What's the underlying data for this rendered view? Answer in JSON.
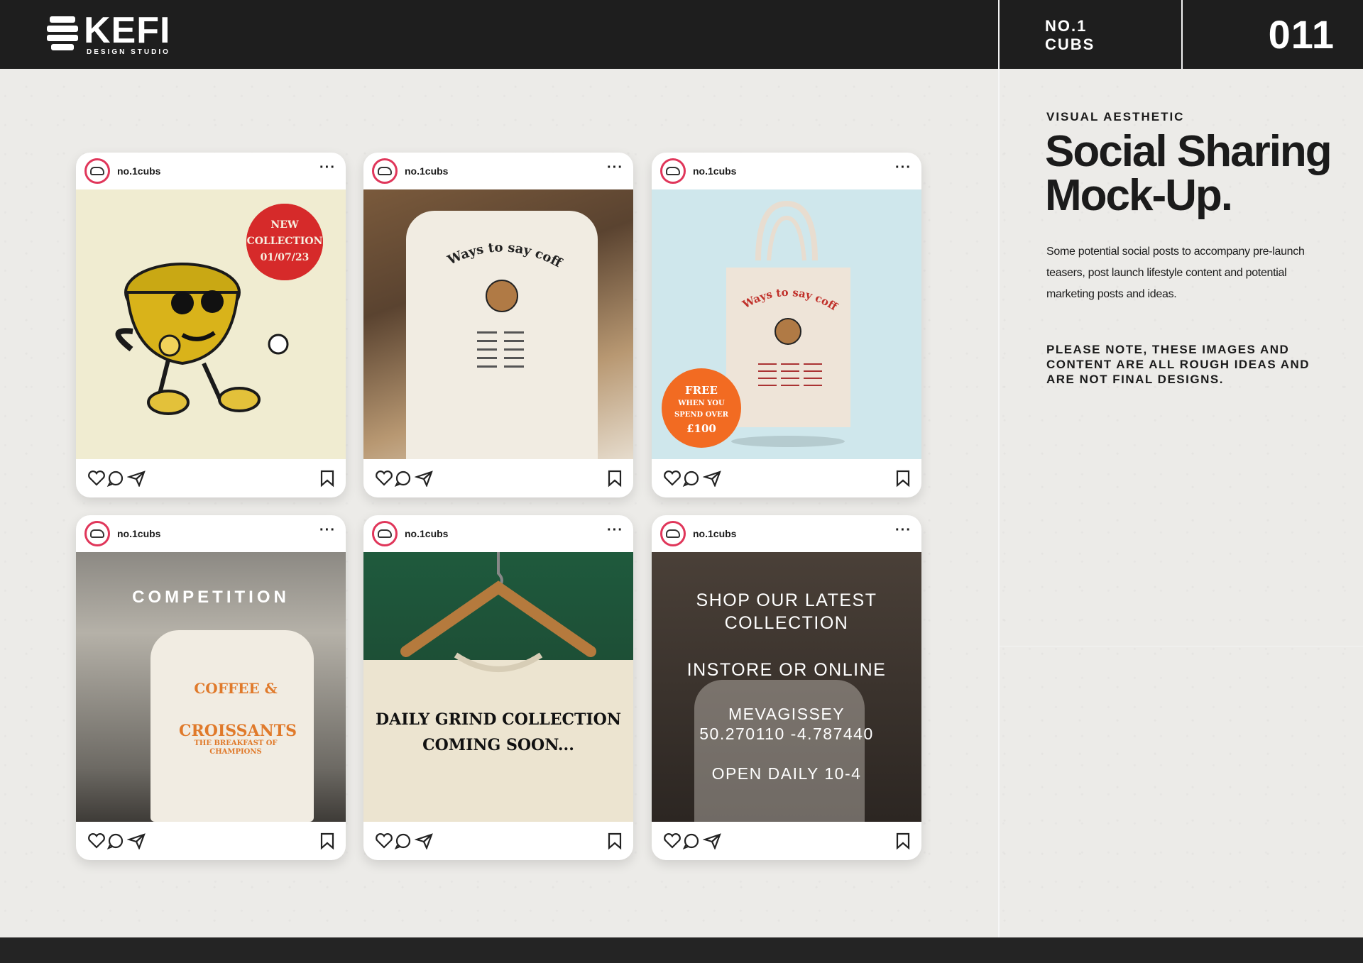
{
  "header": {
    "logo": "KEFI",
    "logo_sub": "DESIGN STUDIO",
    "client_line1": "NO.1",
    "client_line2": "CUBS",
    "page_number": "011"
  },
  "aside": {
    "label": "VISUAL AESTHETIC",
    "title": "Social Sharing Mock-Up.",
    "body": "Some potential social posts to accompany pre-launch teasers, post launch lifestyle content and potential marketing posts and ideas.",
    "note": "PLEASE NOTE, THESE IMAGES AND CONTENT ARE ALL ROUGH IDEAS AND ARE NOT FINAL DESIGNS."
  },
  "posts": [
    {
      "username": "no.1cubs",
      "more": "···",
      "badge": [
        "NEW",
        "COLLECTION",
        "01/07/23"
      ]
    },
    {
      "username": "no.1cubs",
      "more": "···",
      "shirt_text": "Ways to say coffee"
    },
    {
      "username": "no.1cubs",
      "more": "···",
      "bag_text": "Ways to say coffee",
      "badge": [
        "FREE",
        "WHEN YOU",
        "SPEND OVER",
        "£100"
      ]
    },
    {
      "username": "no.1cubs",
      "more": "···",
      "overlay": "COMPETITION",
      "shirt_text": [
        "COFFEE &",
        "CROISSANTS",
        "THE BREAKFAST OF CHAMPIONS"
      ]
    },
    {
      "username": "no.1cubs",
      "more": "···",
      "overlay": [
        "DAILY GRIND COLLECTION",
        "COMING SOON..."
      ]
    },
    {
      "username": "no.1cubs",
      "more": "···",
      "overlay": [
        "SHOP OUR LATEST",
        "COLLECTION",
        "INSTORE OR ONLINE",
        "MEVAGISSEY",
        "50.270110 -4.787440",
        "OPEN DAILY 10-4"
      ]
    }
  ],
  "colors": {
    "accent_red": "#d62a2a",
    "accent_orange": "#f26b22",
    "dark": "#1e1e1e"
  }
}
